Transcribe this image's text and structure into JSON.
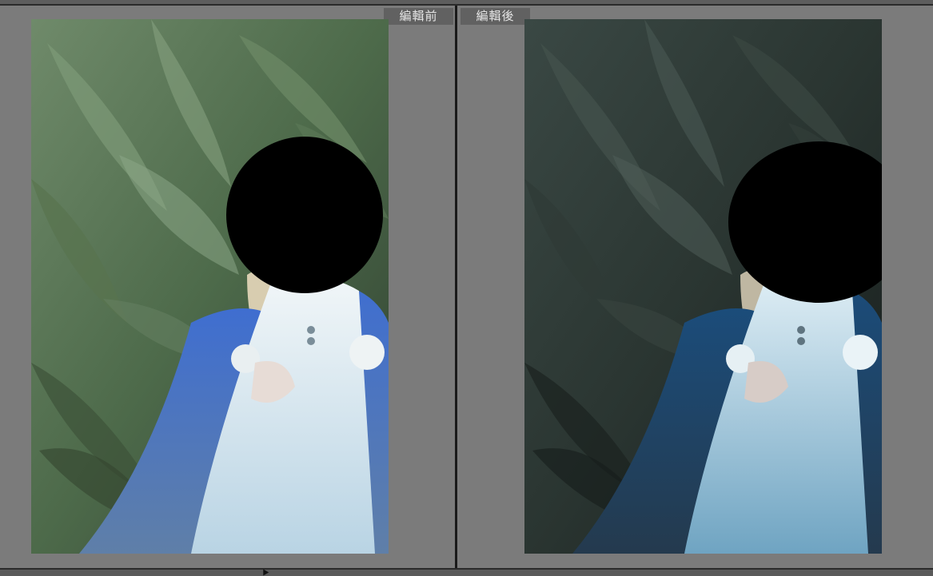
{
  "panes": {
    "before": {
      "label": "編輯前"
    },
    "after": {
      "label": "編輯後"
    }
  },
  "colors": {
    "background": "#7b7b7b",
    "divider": "#1a1a1a",
    "label_bg": "#616161",
    "label_text": "#e6e6e6",
    "before_foliage": "#4f6a4c",
    "after_foliage": "#2c3733",
    "cloak_before": "#3d63b8",
    "cloak_after": "#183e63",
    "robe": "#cfe0ea",
    "redaction": "#000000"
  },
  "icons": {
    "cursor": "pointer-cursor-icon"
  }
}
